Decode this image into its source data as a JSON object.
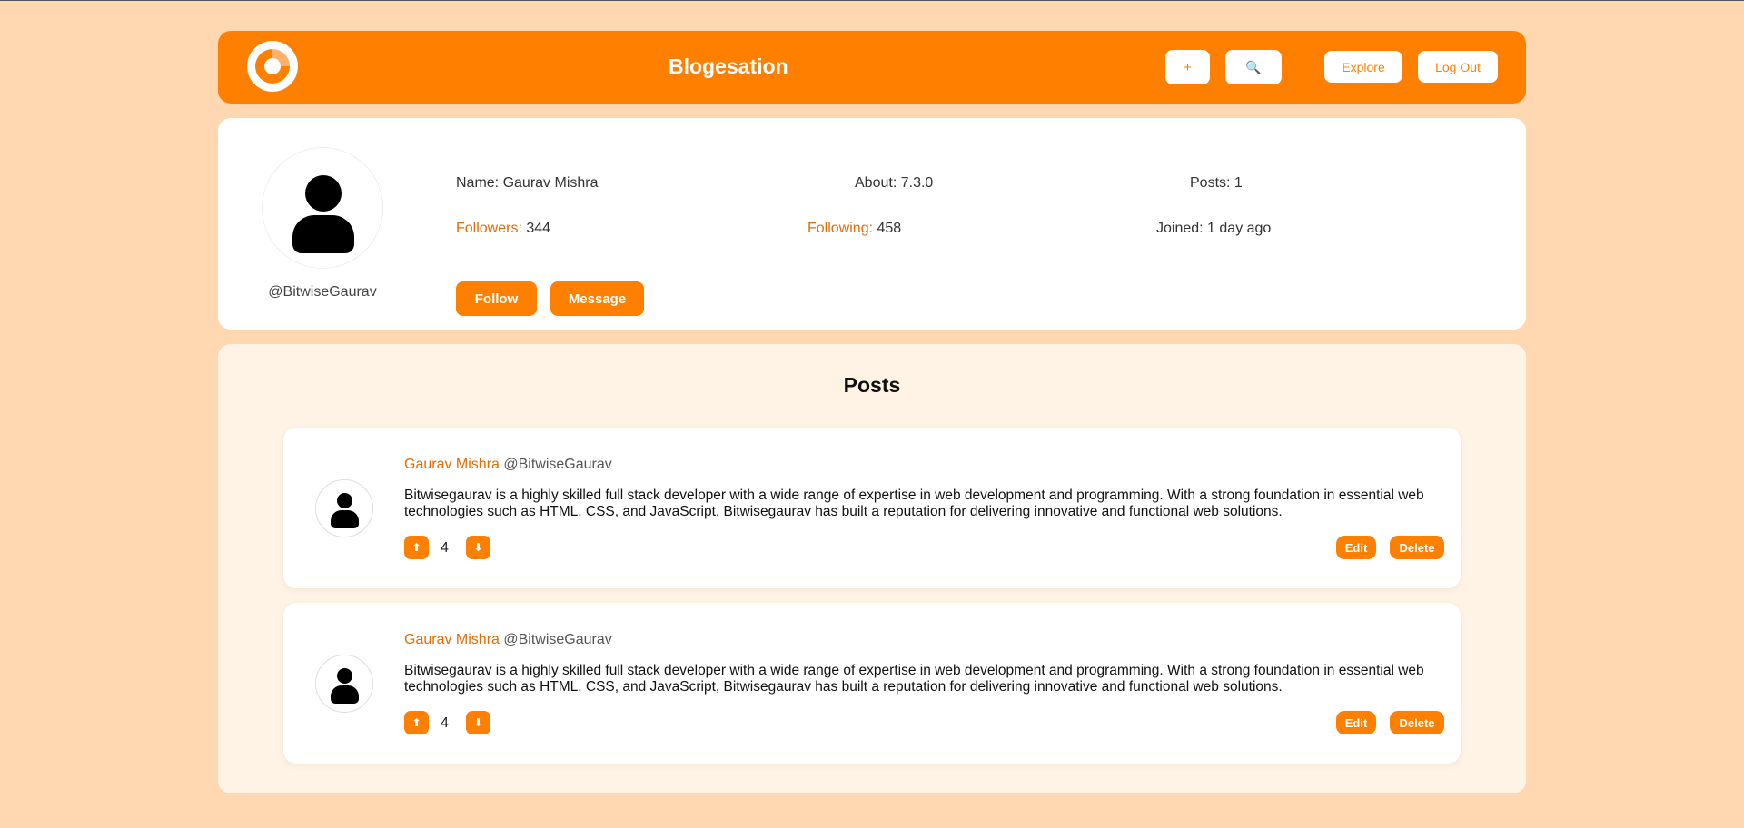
{
  "header": {
    "brand": "Blogesation",
    "add_label": "+",
    "search_icon": "🔍",
    "explore_label": "Explore",
    "logout_label": "Log Out"
  },
  "profile": {
    "handle": "@BitwiseGaurav",
    "name_label": "Name:",
    "name": "Gaurav Mishra",
    "about_label": "About:",
    "about": "7.3.0",
    "posts_label": "Posts:",
    "posts": "1",
    "followers_label": "Followers:",
    "followers": "344",
    "following_label": "Following:",
    "following": "458",
    "joined_label": "Joined:",
    "joined": "1 day ago",
    "follow_label": "Follow",
    "message_label": "Message"
  },
  "posts_section": {
    "title": "Posts",
    "items": [
      {
        "author": "Gaurav Mishra",
        "handle": "@BitwiseGaurav",
        "text": "Bitwisegaurav is a highly skilled full stack developer with a wide range of expertise in web development and programming. With a strong foundation in essential web technologies such as HTML, CSS, and JavaScript, Bitwisegaurav has built a reputation for delivering innovative and functional web solutions.",
        "upvote_icon": "⬆",
        "votes": "4",
        "downvote_icon": "⬇",
        "edit_label": "Edit",
        "delete_label": "Delete"
      },
      {
        "author": "Gaurav Mishra",
        "handle": "@BitwiseGaurav",
        "text": "Bitwisegaurav is a highly skilled full stack developer with a wide range of expertise in web development and programming. With a strong foundation in essential web technologies such as HTML, CSS, and JavaScript, Bitwisegaurav has built a reputation for delivering innovative and functional web solutions.",
        "upvote_icon": "⬆",
        "votes": "4",
        "downvote_icon": "⬇",
        "edit_label": "Edit",
        "delete_label": "Delete"
      }
    ]
  },
  "colors": {
    "accent": "#ff8000",
    "page_background": "#ffd8b1",
    "name_accent": "#e36c06"
  }
}
